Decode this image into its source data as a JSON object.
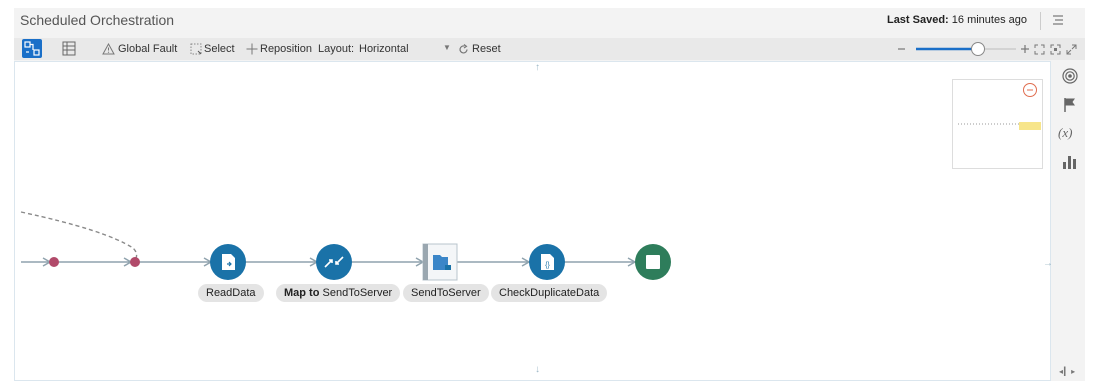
{
  "header": {
    "title": "Scheduled Orchestration",
    "last_saved_label": "Last Saved:",
    "last_saved_value": "16 minutes ago"
  },
  "toolbar": {
    "global_fault": "Global Fault",
    "select": "Select",
    "reposition": "Reposition",
    "layout_label": "Layout:",
    "layout_value": "Horizontal",
    "reset": "Reset",
    "zoom_level": 0.85
  },
  "flow": {
    "nodes": [
      {
        "label": "ReadData",
        "icon": "read-file-icon",
        "color": "#1a72a8"
      },
      {
        "label_bold": "Map to",
        "label": "SendToServer",
        "icon": "map-arrows-icon",
        "color": "#1a72a8"
      },
      {
        "label": "SendToServer",
        "icon": "ftp-adapter-icon",
        "color": "#3b86c8"
      },
      {
        "label": "CheckDuplicateData",
        "icon": "code-file-icon",
        "color": "#1a72a8"
      },
      {
        "label": "",
        "icon": "stop-icon",
        "color": "#2e7d5b"
      }
    ]
  },
  "right_rail": {
    "icons": [
      "target-icon",
      "flag-icon",
      "variable-icon",
      "chart-icon"
    ],
    "variable_text": "(x)"
  },
  "colors": {
    "accent": "#1a6fc8",
    "node_blue": "#1a72a8",
    "end_green": "#2e7d5b",
    "junction": "#b14a6a"
  }
}
